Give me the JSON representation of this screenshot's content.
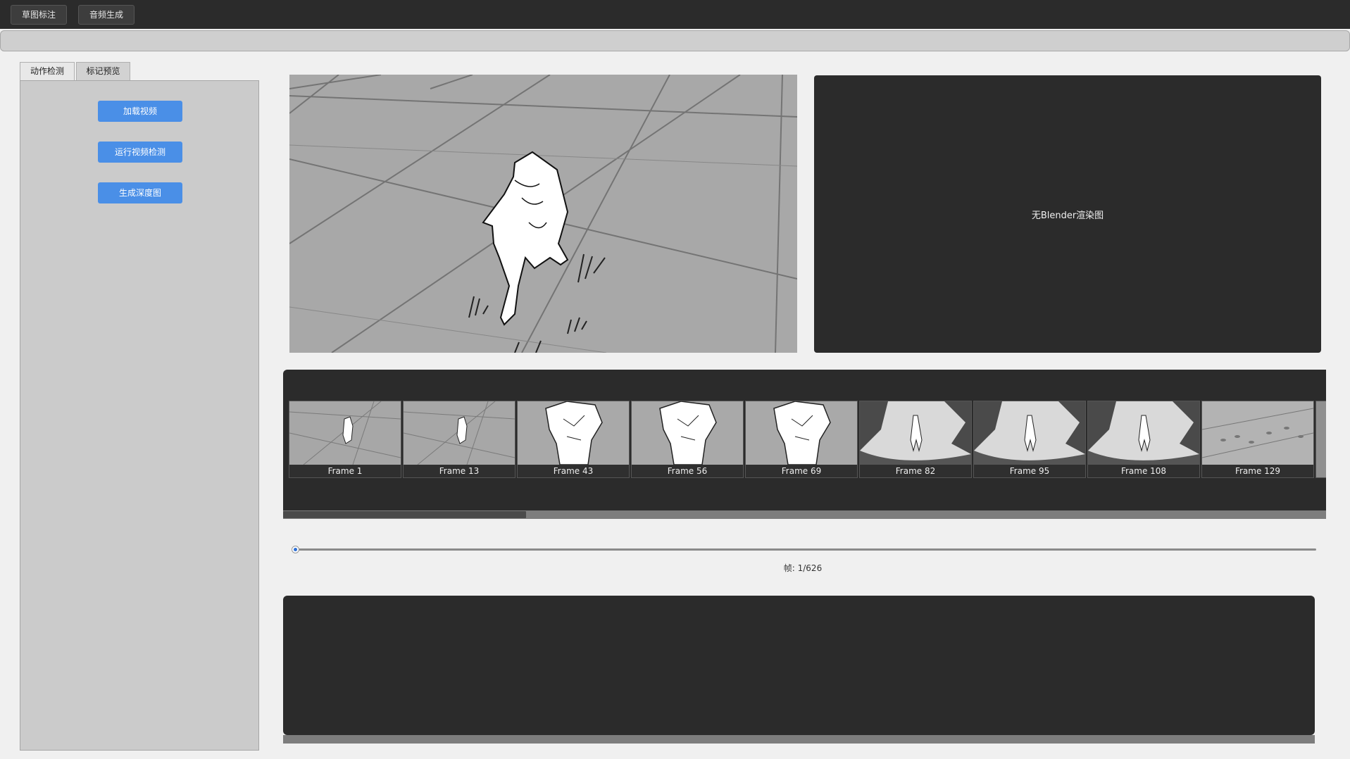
{
  "toolbar": {
    "sketch_annotation": "草图标注",
    "audio_generation": "音频生成"
  },
  "tabs": [
    {
      "label": "动作检测",
      "active": true
    },
    {
      "label": "标记预览",
      "active": false
    }
  ],
  "side_panel": {
    "load_video": "加载视频",
    "run_video_detection": "运行视频检测",
    "generate_depth_map": "生成深度图"
  },
  "render_viewer": {
    "placeholder": "无Blender渲染图"
  },
  "timeline": {
    "frames": [
      {
        "label": "Frame 1",
        "style": "floor"
      },
      {
        "label": "Frame 13",
        "style": "floor"
      },
      {
        "label": "Frame 43",
        "style": "closeup"
      },
      {
        "label": "Frame 56",
        "style": "closeup"
      },
      {
        "label": "Frame 69",
        "style": "closeup"
      },
      {
        "label": "Frame 82",
        "style": "dark"
      },
      {
        "label": "Frame 95",
        "style": "dark"
      },
      {
        "label": "Frame 108",
        "style": "dark"
      },
      {
        "label": "Frame 129",
        "style": "tracks"
      }
    ]
  },
  "frame_slider": {
    "label": "帧: 1/626",
    "current": 1,
    "total": 626
  },
  "colors": {
    "accent_button": "#4a8fe7",
    "dark_panel": "#2b2b2b",
    "slider_knob": "#2d6fd6"
  }
}
